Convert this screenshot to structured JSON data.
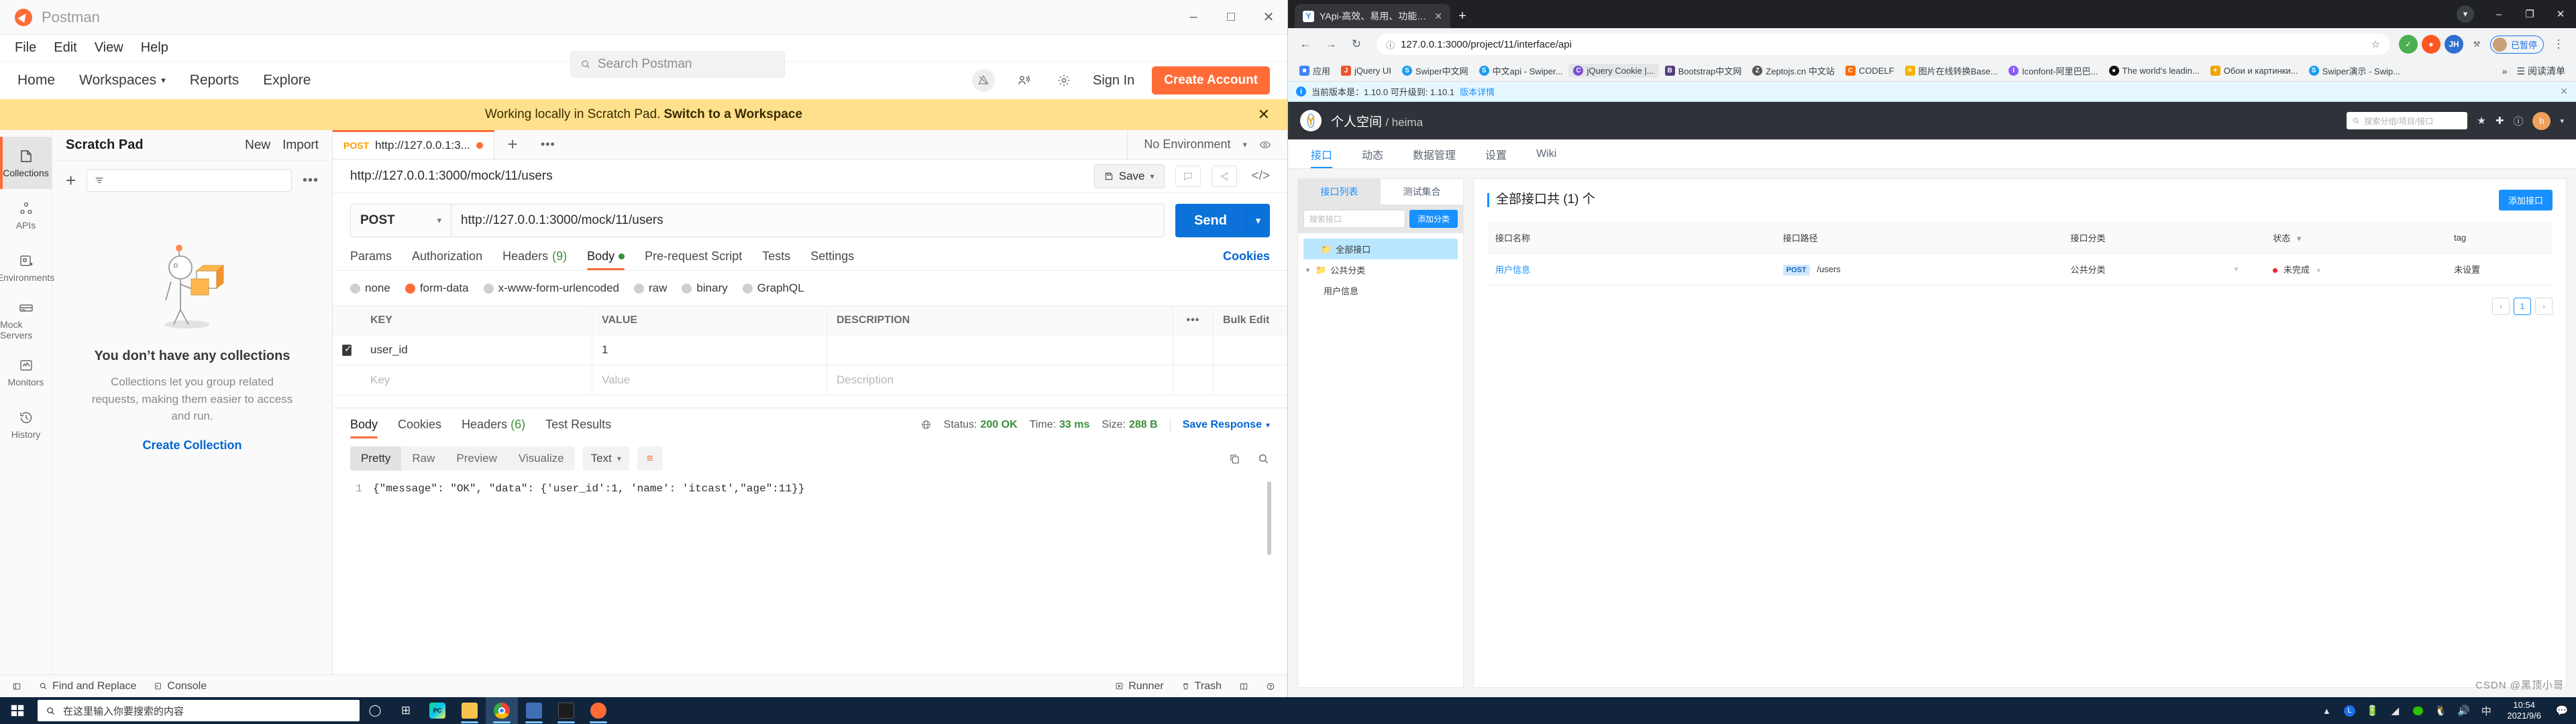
{
  "postman": {
    "app_title": "Postman",
    "window_controls": [
      "minimize",
      "maximize",
      "close"
    ],
    "menu": [
      "File",
      "Edit",
      "View",
      "Help"
    ],
    "nav": [
      "Home",
      "Workspaces",
      "Reports",
      "Explore"
    ],
    "search_placeholder": "Search Postman",
    "sign_in": "Sign In",
    "create_account": "Create Account",
    "banner": {
      "text": "Working locally in Scratch Pad.",
      "link": "Switch to a Workspace",
      "close": "✕"
    },
    "rail": [
      {
        "label": "Collections",
        "icon": "collections-icon",
        "selected": true
      },
      {
        "label": "APIs",
        "icon": "apis-icon",
        "selected": false
      },
      {
        "label": "Environments",
        "icon": "environments-icon",
        "selected": false
      },
      {
        "label": "Mock Servers",
        "icon": "mock-servers-icon",
        "selected": false
      },
      {
        "label": "Monitors",
        "icon": "monitors-icon",
        "selected": false
      },
      {
        "label": "History",
        "icon": "history-icon",
        "selected": false
      }
    ],
    "sidebar": {
      "title": "Scratch Pad",
      "new_button": "New",
      "import_button": "Import",
      "more": "•••",
      "add": "+",
      "filter_icon": "filter-icon",
      "empty_title": "You don’t have any collections",
      "empty_desc": "Collections let you group related requests, making them easier to access and run.",
      "empty_link": "Create Collection"
    },
    "tab": {
      "method": "POST",
      "name": "http://127.0.0.1:3...",
      "unsaved": true,
      "add": "+",
      "more": "•••"
    },
    "environment": {
      "selected": "No Environment",
      "eye_icon": "eye-icon"
    },
    "request": {
      "name": "http://127.0.0.1:3000/mock/11/users",
      "save_label": "Save",
      "method": "POST",
      "url": "http://127.0.0.1:3000/mock/11/users",
      "send_label": "Send",
      "tabs": [
        {
          "label": "Params",
          "selected": false
        },
        {
          "label": "Authorization",
          "selected": false
        },
        {
          "label": "Headers",
          "count": "(9)",
          "selected": false
        },
        {
          "label": "Body",
          "dot": true,
          "selected": true
        },
        {
          "label": "Pre-request Script",
          "selected": false
        },
        {
          "label": "Tests",
          "selected": false
        },
        {
          "label": "Settings",
          "selected": false
        }
      ],
      "cookies_link": "Cookies",
      "body_types": [
        {
          "label": "none",
          "selected": false
        },
        {
          "label": "form-data",
          "selected": true
        },
        {
          "label": "x-www-form-urlencoded",
          "selected": false
        },
        {
          "label": "raw",
          "selected": false
        },
        {
          "label": "binary",
          "selected": false
        },
        {
          "label": "GraphQL",
          "selected": false
        }
      ],
      "table": {
        "headers": [
          "KEY",
          "VALUE",
          "DESCRIPTION"
        ],
        "bulk_edit": "Bulk Edit",
        "more": "•••",
        "rows": [
          {
            "checked": true,
            "key": "user_id",
            "value": "1",
            "description": ""
          }
        ],
        "placeholders": {
          "key": "Key",
          "value": "Value",
          "description": "Description"
        }
      }
    },
    "response": {
      "tabs": [
        {
          "label": "Body",
          "selected": true
        },
        {
          "label": "Cookies",
          "selected": false
        },
        {
          "label": "Headers",
          "count": "(6)",
          "selected": false
        },
        {
          "label": "Test Results",
          "selected": false
        }
      ],
      "status_label": "Status:",
      "status_value": "200 OK",
      "time_label": "Time:",
      "time_value": "33 ms",
      "size_label": "Size:",
      "size_value": "288 B",
      "save_response": "Save Response",
      "view_modes": [
        {
          "label": "Pretty",
          "selected": true
        },
        {
          "label": "Raw",
          "selected": false
        },
        {
          "label": "Preview",
          "selected": false
        },
        {
          "label": "Visualize",
          "selected": false
        }
      ],
      "format": "Text",
      "line_number": "1",
      "body": "{\"message\": \"OK\", \"data\": {'user_id':1, 'name': 'itcast',\"age\":11}}"
    },
    "status_bar": {
      "find_replace": "Find and Replace",
      "console": "Console",
      "runner": "Runner",
      "trash": "Trash"
    }
  },
  "browser": {
    "tab_title": "YApi-高效、易用、功能强大的可...",
    "tab_close": "✕",
    "new_tab": "+",
    "url": "127.0.0.1:3000/project/11/interface/api",
    "profile_label": "已暂停",
    "bookmarks": [
      {
        "label": "应用",
        "color": "#4285f4"
      },
      {
        "label": "jQuery UI",
        "color": "#e8562c"
      },
      {
        "label": "Swiper中文网",
        "color": "#1a9cf0"
      },
      {
        "label": "中文api - Swiper...",
        "color": "#1a9cf0"
      },
      {
        "label": "jQuery Cookie |...",
        "color": "#7a4fd1",
        "highlight": true
      },
      {
        "label": "Bootstrap中文网",
        "color": "#563d7c"
      },
      {
        "label": "Zeptojs.cn 中文站",
        "color": "#555555"
      },
      {
        "label": "CODELF",
        "color": "#ff6a00"
      },
      {
        "label": "图片在线转换Base...",
        "color": "#f5b301"
      },
      {
        "label": "Iconfont-阿里巴巴...",
        "color": "#8b5cf6"
      },
      {
        "label": "The world's leadin...",
        "color": "#111111"
      },
      {
        "label": "Обои и картинки...",
        "color": "#f0a500"
      },
      {
        "label": "Swiper演示 - Swip...",
        "color": "#1a9cf0"
      }
    ],
    "bookmarks_overflow": "»",
    "bookmarks_reading_list": "阅读清单"
  },
  "yapi": {
    "alert": {
      "text": "当前版本是：1.10.0 可升级到: 1.10.1",
      "link": "版本详情",
      "close": "✕"
    },
    "brand": "个人空间",
    "brand_sub": "/ heima",
    "search_placeholder": "搜索分组/项目/接口",
    "nav": [
      {
        "label": "接口",
        "selected": true
      },
      {
        "label": "动态",
        "selected": false
      },
      {
        "label": "数据管理",
        "selected": false
      },
      {
        "label": "设置",
        "selected": false
      },
      {
        "label": "Wiki",
        "selected": false
      }
    ],
    "side": {
      "tabs": [
        {
          "label": "接口列表",
          "selected": true
        },
        {
          "label": "测试集合",
          "selected": false
        }
      ],
      "search_placeholder": "搜索接口",
      "add_category": "添加分类",
      "tree": [
        {
          "label": "全部接口",
          "selected": true,
          "expandable": false
        },
        {
          "label": "公共分类",
          "selected": false,
          "expandable": true
        }
      ],
      "leaf": "用户信息"
    },
    "main": {
      "title": "全部接口共 (1) 个",
      "add_button": "添加接口",
      "headers": [
        "接口名称",
        "接口路径",
        "接口分类",
        "状态",
        "tag"
      ],
      "rows": [
        {
          "name": "用户信息",
          "method": "POST",
          "path": "/users",
          "category": "公共分类",
          "status": "未完成",
          "tag": "未设置"
        }
      ],
      "pager": {
        "prev": "‹",
        "current": "1",
        "next": "›"
      }
    }
  },
  "taskbar": {
    "search_placeholder": "在这里输入你要搜索的内容",
    "time": "10:54",
    "date": "2021/9/6",
    "ime": "中"
  },
  "watermark": "CSDN @黑顶小哥"
}
